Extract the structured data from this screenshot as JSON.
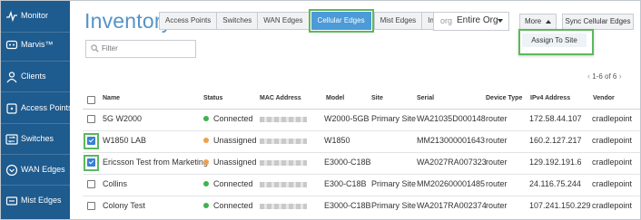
{
  "colors": {
    "sidebar_bg": "#1e5b8e",
    "title_color": "#5593c6",
    "active_tab": "#4c9ad8",
    "highlight": "#5cb85c",
    "connected": "#3fb34f",
    "unassigned": "#f0a04b",
    "checkbox_checked": "#3a7fd4"
  },
  "sidebar": {
    "items": [
      {
        "label": "Monitor",
        "icon": "monitor-icon"
      },
      {
        "label": "Marvis™",
        "icon": "marvis-icon"
      },
      {
        "label": "Clients",
        "icon": "clients-icon"
      },
      {
        "label": "Access Points",
        "icon": "access-point-icon"
      },
      {
        "label": "Switches",
        "icon": "switch-icon"
      },
      {
        "label": "WAN Edges",
        "icon": "wan-edge-icon"
      },
      {
        "label": "Mist Edges",
        "icon": "mist-edge-icon"
      }
    ]
  },
  "header": {
    "title": "Inventory",
    "tabs": [
      {
        "label": "Access Points",
        "active": false
      },
      {
        "label": "Switches",
        "active": false
      },
      {
        "label": "WAN Edges",
        "active": false
      },
      {
        "label": "Cellular Edges",
        "active": true
      },
      {
        "label": "Mist Edges",
        "active": false
      },
      {
        "label": "Installed Base",
        "active": false
      }
    ],
    "org_prefix": "org",
    "org_value": "Entire Org",
    "more_label": "More",
    "sync_label": "Sync Cellular Edges",
    "menu_items": [
      "Assign To Site"
    ]
  },
  "filter": {
    "placeholder": "Filter",
    "value": ""
  },
  "pager": {
    "label": "1-6 of 6"
  },
  "table": {
    "columns": [
      "Name",
      "Status",
      "MAC Address",
      "Model",
      "Site",
      "Serial",
      "Device Type",
      "IPv4 Address",
      "Vendor"
    ],
    "rows": [
      {
        "checked": false,
        "name": "5G W2000",
        "status": "Connected",
        "status_kind": "connected",
        "model": "W2000-5GB",
        "site": "Primary Site",
        "serial": "WA21035D000148",
        "device_type": "router",
        "ipv4": "172.58.44.107",
        "vendor": "cradlepoint"
      },
      {
        "checked": true,
        "name": "W1850 LAB",
        "status": "Unassigned",
        "status_kind": "unassigned",
        "model": "W1850",
        "site": "",
        "serial": "MM213000001643",
        "device_type": "router",
        "ipv4": "160.2.127.217",
        "vendor": "cradlepoint"
      },
      {
        "checked": true,
        "name": "Ericsson Test from Marketing",
        "status": "Unassigned",
        "status_kind": "unassigned",
        "model": "E3000-C18B",
        "site": "",
        "serial": "WA2027RA007323",
        "device_type": "router",
        "ipv4": "129.192.191.6",
        "vendor": "cradlepoint"
      },
      {
        "checked": false,
        "name": "Collins",
        "status": "Connected",
        "status_kind": "connected",
        "model": "E300-C18B",
        "site": "Primary Site",
        "serial": "MM202600001485",
        "device_type": "router",
        "ipv4": "24.116.75.244",
        "vendor": "cradlepoint"
      },
      {
        "checked": false,
        "name": "Colony Test",
        "status": "Connected",
        "status_kind": "connected",
        "model": "E3000-C18B",
        "site": "Primary Site",
        "serial": "WA2017RA002374",
        "device_type": "router",
        "ipv4": "107.241.150.229",
        "vendor": "cradlepoint"
      }
    ]
  }
}
